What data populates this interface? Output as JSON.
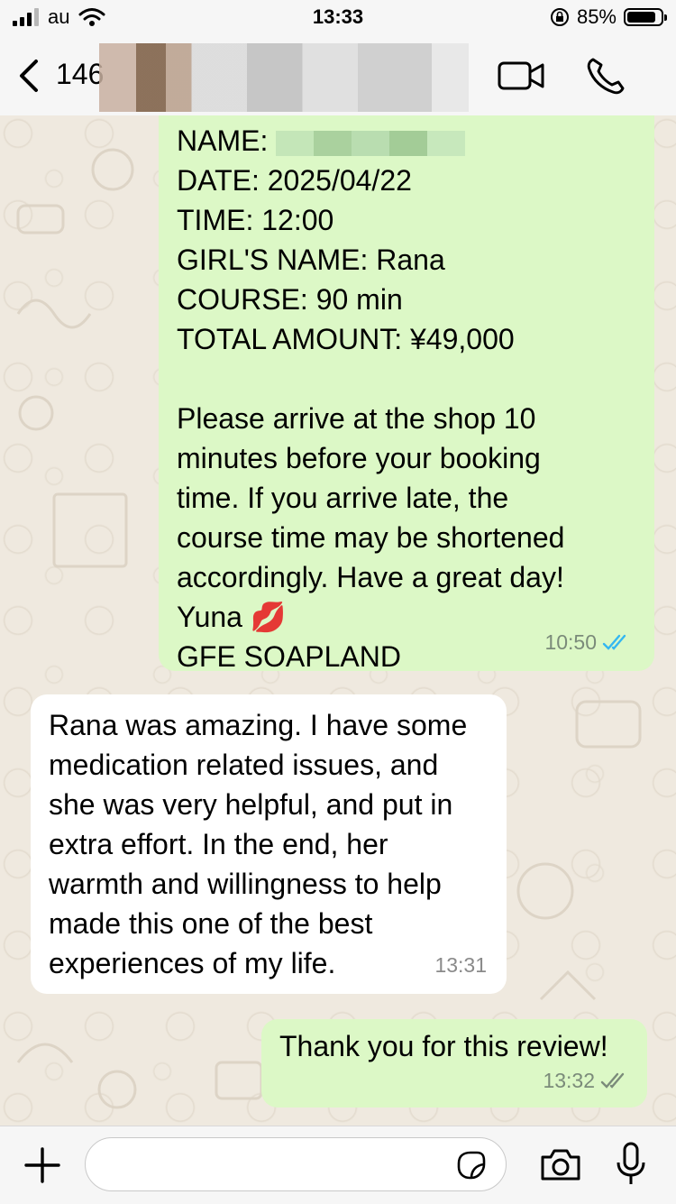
{
  "status_bar": {
    "carrier": "au",
    "time": "13:33",
    "battery": "85%",
    "battery_level": 0.85
  },
  "header": {
    "contact_label": "146"
  },
  "messages": [
    {
      "direction": "outgoing",
      "lines": [
        "NAME:",
        "DATE: 2025/04/22",
        "TIME: 12:00",
        "GIRL'S NAME: Rana",
        "COURSE: 90 min",
        "TOTAL AMOUNT: ¥49,000",
        "",
        "Please arrive at the shop 10",
        "minutes before your booking",
        "time. If you arrive late, the",
        "course time may be shortened",
        "accordingly. Have a great day!",
        "Yuna 💋",
        "GFE SOAPLAND"
      ],
      "time": "10:50"
    },
    {
      "direction": "incoming",
      "lines": [
        "Rana was amazing. I have some",
        "medication related issues, and",
        "she was very helpful, and put in",
        "extra effort. In the end, her",
        "warmth and willingness to help",
        "made this one of the best",
        "experiences of my life."
      ],
      "time": "13:31"
    },
    {
      "direction": "outgoing",
      "lines": [
        "Thank you for this review!"
      ],
      "time": "13:32"
    }
  ],
  "icons": {
    "back": "chevron-left-icon",
    "video": "video-camera-icon",
    "call": "phone-icon",
    "add": "plus-icon",
    "sticker": "sticker-icon",
    "camera": "camera-icon",
    "mic": "microphone-icon"
  },
  "colors": {
    "outgoing": "#dcf8c6",
    "incoming": "#ffffff",
    "read_ticks": "#34b7f1"
  }
}
